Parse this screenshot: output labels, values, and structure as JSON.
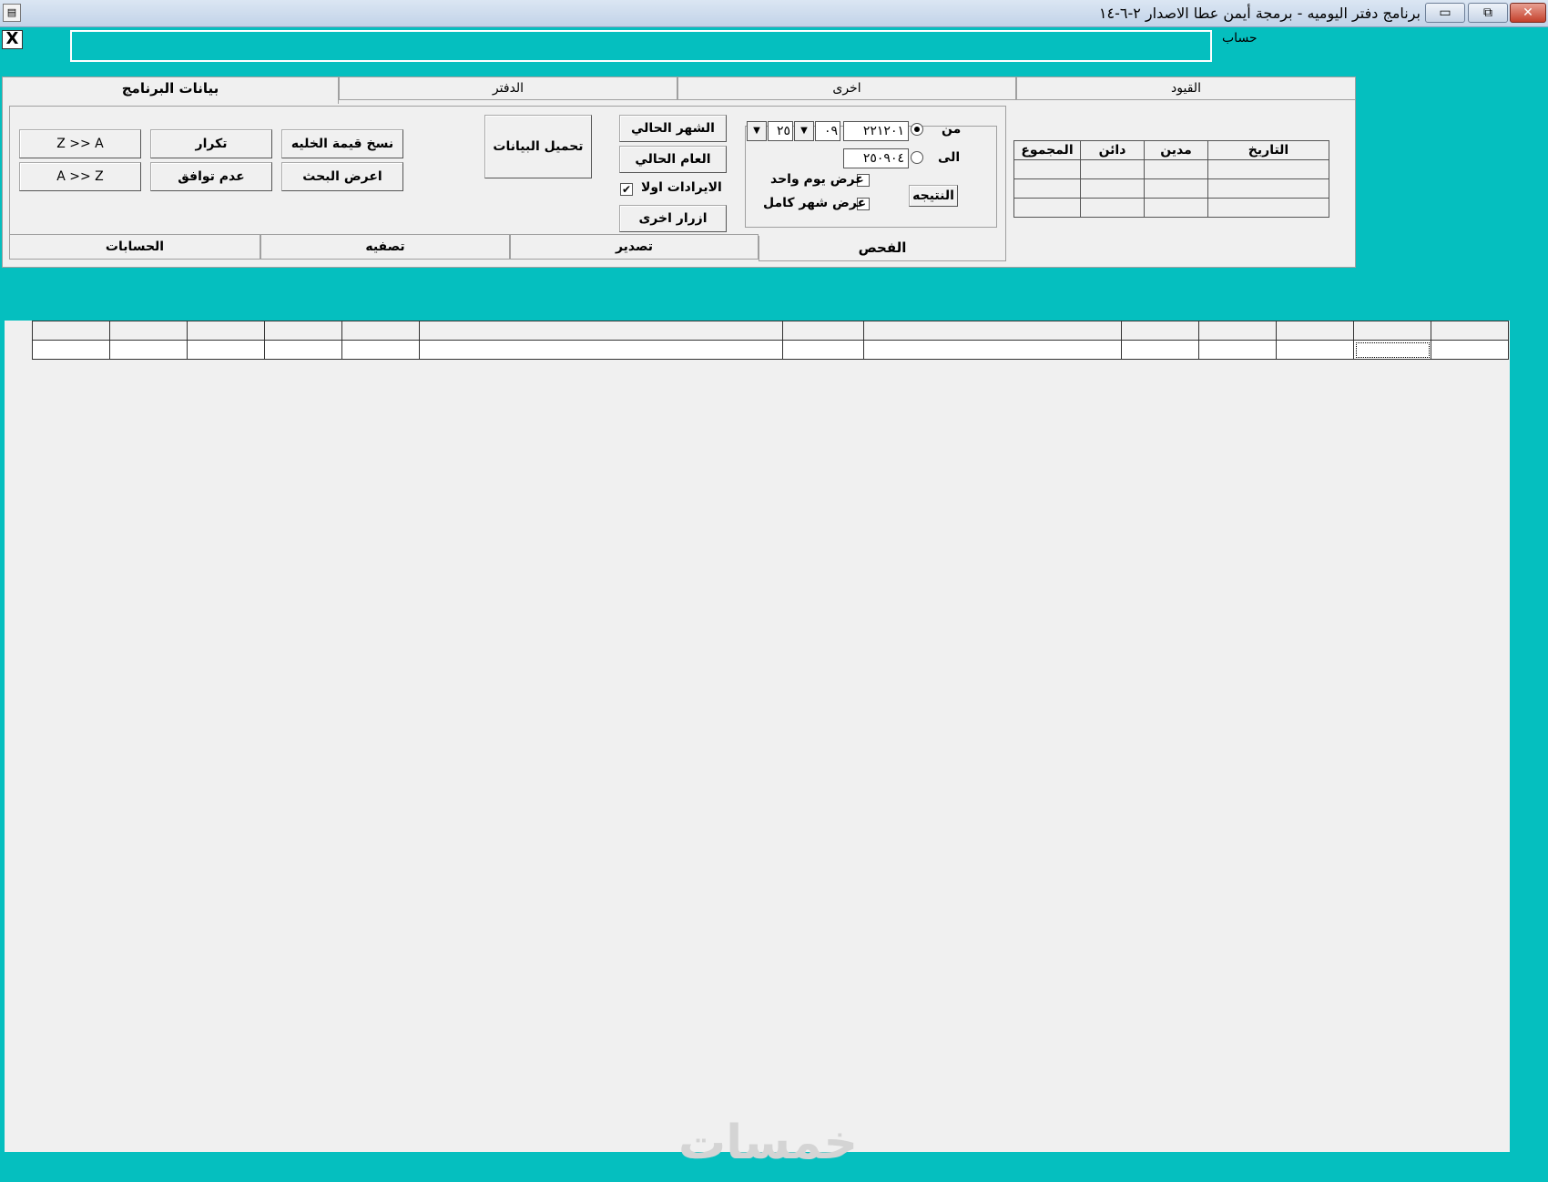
{
  "window": {
    "title": "برنامج دفتر اليوميه - برمجة أيمن عطا الاصدار ٢-٦-١٤",
    "app_icon": "app-icon",
    "minimize_glyph": "▭",
    "restore_glyph": "⧉",
    "close_glyph": "✕"
  },
  "top": {
    "x_button": "X",
    "account_label": "حساب",
    "account_value": ""
  },
  "top_tabs": [
    "القيود",
    "اخرى",
    "الدفتر",
    "بيانات البرنامج"
  ],
  "panel": {
    "buttons": {
      "z_to_a": "Z >> A",
      "a_to_z": "A >> Z",
      "repeat": "تكرار",
      "mismatch": "عدم توافق",
      "copy_cell": "نسخ قيمة الخليه",
      "show_search": "اعرض البحث",
      "load_data": "تحميل البيانات",
      "current_month": "الشهر الحالي",
      "current_year": "العام الحالي",
      "revenue_first": "الايرادات اولا",
      "other_buttons": "ازرار اخرى",
      "result": "النتيجه"
    },
    "revenue_first_checked": true,
    "date_filter": {
      "from_label": "من",
      "to_label": "الى",
      "from_value": "٢٢١٢٠١",
      "to_value": "٢٥٠٩٠٤",
      "from_selected": true,
      "year_value": "٢٥",
      "month_value": "٠٩",
      "one_day_label": "عرض يوم واحد",
      "full_month_label": "عرض شهر كامل",
      "one_day_checked": false,
      "full_month_checked": false
    }
  },
  "bottom_tabs": [
    "الفحص",
    "تصدير",
    "تصفيه",
    "الحسابات"
  ],
  "summary_table": {
    "headers": [
      "التاريخ",
      "مدين",
      "دائن",
      "المجموع"
    ],
    "rows": [
      [
        "",
        "",
        "",
        ""
      ],
      [
        "",
        "",
        "",
        ""
      ],
      [
        "",
        "",
        "",
        ""
      ]
    ]
  },
  "grid": {
    "rows": 2,
    "columns": 14
  },
  "watermark": "خمسات"
}
